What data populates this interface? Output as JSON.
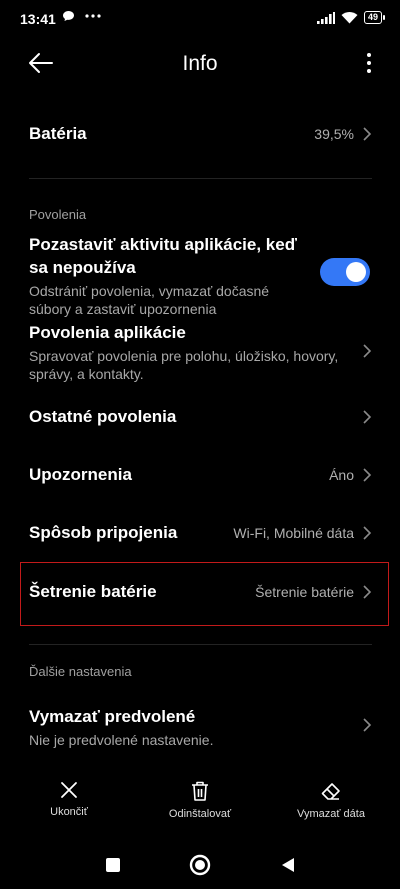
{
  "status_bar": {
    "time": "13:41",
    "battery_level": "49"
  },
  "header": {
    "title": "Info"
  },
  "battery_row": {
    "title": "Batéria",
    "value": "39,5%"
  },
  "permissions_section": {
    "label": "Povolenia",
    "pause_activity": {
      "title": "Pozastaviť aktivitu aplikácie, keď sa nepoužíva",
      "subtitle": "Odstrániť povolenia, vymazať dočasné súbory a zastaviť upozornenia",
      "enabled": true
    },
    "app_permissions": {
      "title": "Povolenia aplikácie",
      "subtitle": "Spravovať povolenia pre polohu, úložisko, hovory, správy, a kontakty."
    },
    "other_permissions": {
      "title": "Ostatné povolenia"
    },
    "notifications": {
      "title": "Upozornenia",
      "value": "Áno"
    },
    "connection": {
      "title": "Spôsob pripojenia",
      "value": "Wi-Fi, Mobilné dáta"
    },
    "battery_saver": {
      "title": "Šetrenie batérie",
      "value": "Šetrenie batérie"
    }
  },
  "more_section": {
    "label": "Ďalšie nastavenia",
    "clear_defaults": {
      "title": "Vymazať predvolené",
      "subtitle": "Nie je predvolené nastavenie."
    }
  },
  "actions": {
    "stop": "Ukončiť",
    "uninstall": "Odinštalovať",
    "clear_data": "Vymazať dáta"
  },
  "colors": {
    "accent": "#3478f6",
    "highlight": "#c21a1a"
  }
}
